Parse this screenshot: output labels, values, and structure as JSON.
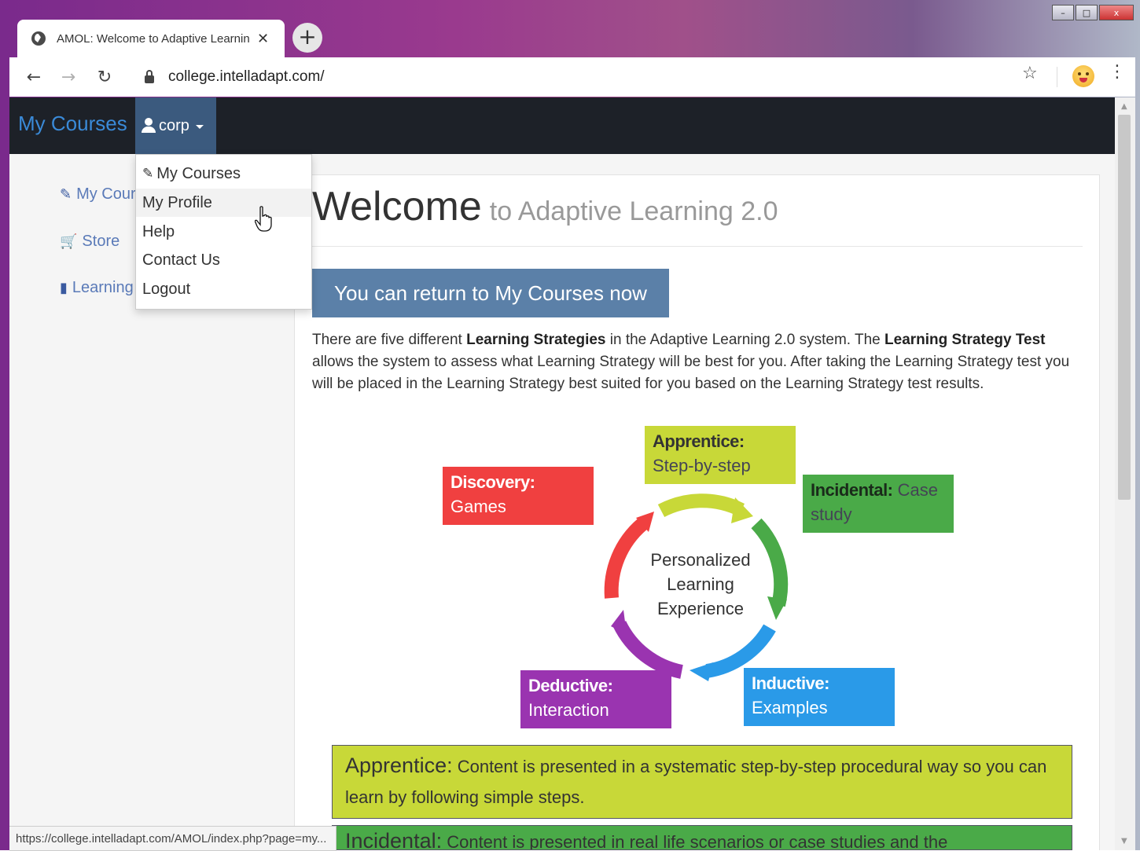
{
  "browser": {
    "tab_title": "AMOL: Welcome to Adaptive Learning",
    "tab_close": "✕",
    "new_tab": "+",
    "url": "college.intelladapt.com/",
    "window_controls": [
      "–",
      "□",
      "x"
    ]
  },
  "navbar": {
    "brand": "My Courses",
    "user_label": "corp"
  },
  "sidebar": {
    "items": [
      {
        "label": "My Courses",
        "icon": "pin-icon"
      },
      {
        "label": "Store",
        "icon": "cart-icon"
      },
      {
        "label": "Learning",
        "icon": "book-icon"
      }
    ]
  },
  "dropdown": {
    "items": [
      {
        "label": "My Courses",
        "icon": "pin-icon"
      },
      {
        "label": "My Profile"
      },
      {
        "label": "Help"
      },
      {
        "label": "Contact Us"
      },
      {
        "label": "Logout"
      }
    ]
  },
  "main": {
    "heading": "Welcome",
    "heading_sub": "to Adaptive Learning 2.0",
    "return_button": "You can return to My Courses now",
    "intro": {
      "p1": "There are five different ",
      "b1": "Learning Strategies",
      "p2": " in the Adaptive Learning 2.0 system. The ",
      "b2": "Learning Strategy Test",
      "p3": " allows the system to assess what Learning Strategy will be best for you. After taking the Learning Strategy test you will be placed in the Learning Strategy best suited for you based on the Learning Strategy test results."
    },
    "diagram": {
      "center": [
        "Personalized",
        "Learning",
        "Experience"
      ],
      "strategies": [
        {
          "key": "discovery",
          "title": "Discovery:",
          "text": "Games",
          "color": "#f04040"
        },
        {
          "key": "apprentice",
          "title": "Apprentice:",
          "text": "Step-by-step",
          "color": "#c8d838"
        },
        {
          "key": "incidental",
          "title": "Incidental:",
          "text": "Case study",
          "color": "#4aaa48"
        },
        {
          "key": "deductive",
          "title": "Deductive:",
          "text": "Interaction",
          "color": "#9a34b0"
        },
        {
          "key": "inductive",
          "title": "Inductive:",
          "text": "Examples",
          "color": "#2a9ae8"
        }
      ]
    },
    "descriptions": {
      "apprentice_term": "Apprentice:",
      "apprentice_text": " Content is presented in a systematic step-by-step procedural way so you can learn by following simple steps.",
      "incidental_term": "Incidental:",
      "incidental_text": " Content is presented in real life scenarios or case studies and the"
    }
  },
  "status_bar": "https://college.intelladapt.com/AMOL/index.php?page=my..."
}
